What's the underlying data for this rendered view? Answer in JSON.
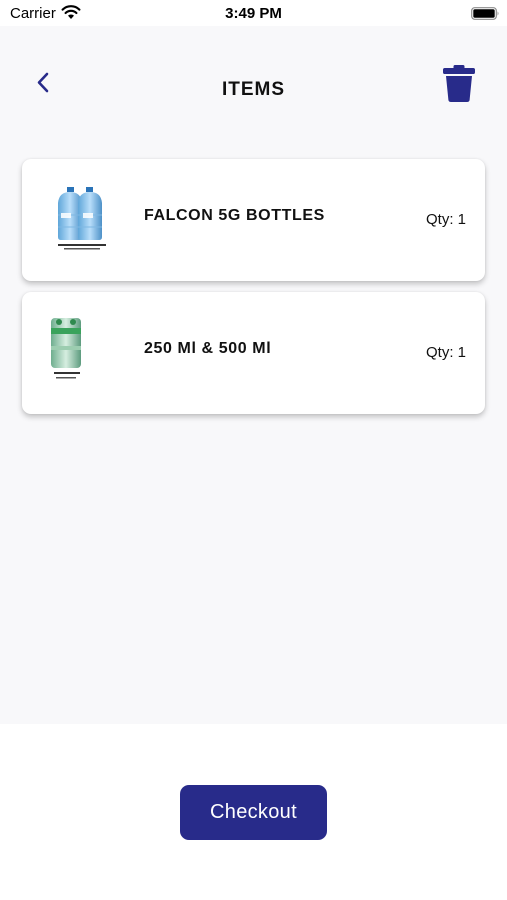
{
  "status_bar": {
    "carrier": "Carrier",
    "time": "3:49 PM"
  },
  "header": {
    "title": "ITEMS",
    "back_icon": "chevron-left-icon",
    "delete_icon": "trash-icon"
  },
  "items": [
    {
      "name": "FALCON 5G BOTTLES",
      "qty": "Qty: 1",
      "image_caption": "FALCON 5 GALLON BOTTLES"
    },
    {
      "name": "250 Ml & 500 Ml",
      "qty": "Qty: 1",
      "image_caption": "250ML & 500ML BOTTLES"
    }
  ],
  "checkout": {
    "label": "Checkout"
  },
  "colors": {
    "accent": "#282b8a",
    "content_background": "#f8f8fa",
    "card_background": "#ffffff"
  }
}
